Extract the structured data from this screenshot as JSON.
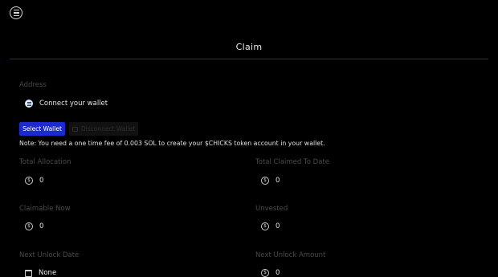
{
  "header": {
    "logo": "menu-circle-icon"
  },
  "page": {
    "title": "Claim"
  },
  "address": {
    "label": "Address",
    "wallet_text": "Connect your wallet",
    "icon": "wallet-icon"
  },
  "buttons": {
    "select_wallet": "Select Wallet",
    "disconnect_wallet": "Disconnect Wallet"
  },
  "note": "Note: You need a one time fee of 0.003 SOL to create your $CHICKS token account in your wallet.",
  "stats": {
    "total_allocation": {
      "label": "Total Allocation",
      "value": "0",
      "icon": "coin-icon"
    },
    "total_claimed": {
      "label": "Total Claimed To Date",
      "value": "0",
      "icon": "coin-icon"
    },
    "claimable_now": {
      "label": "Claimable Now",
      "value": "0",
      "icon": "coin-icon"
    },
    "unvested": {
      "label": "Unvested",
      "value": "0",
      "icon": "coin-icon"
    },
    "next_unlock_date": {
      "label": "Next Unlock Date",
      "value": "None",
      "icon": "calendar-icon"
    },
    "next_unlock_amount": {
      "label": "Next Unlock Amount",
      "value": "0",
      "icon": "coin-icon"
    }
  },
  "colors": {
    "background": "#000000",
    "accent": "#1b2bd0",
    "divider": "#2a2a7a",
    "muted_label": "#4a4a4a"
  }
}
